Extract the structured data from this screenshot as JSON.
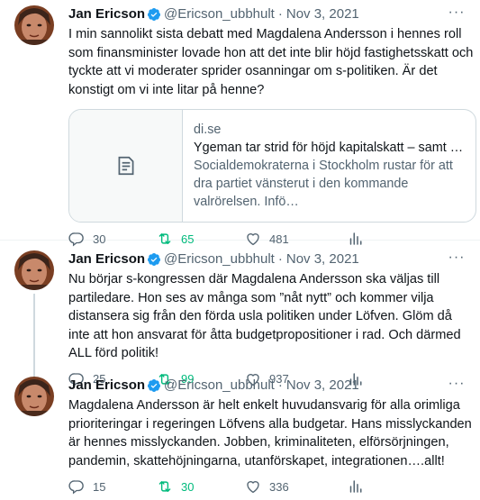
{
  "tweets": [
    {
      "author_name": "Jan Ericson",
      "handle": "@Ericson_ubbhult",
      "separator": "·",
      "date": "Nov 3, 2021",
      "text": "I min sannolikt sista debatt med Magdalena Andersson i hennes roll som finansminister lovade hon att det inte blir höjd fastighetsskatt och tyckte att vi moderater sprider osanningar om s-politiken. Är det konstigt om vi inte litar på henne?",
      "card": {
        "domain": "di.se",
        "title": "Ygeman tar strid för höjd kapitalskatt – samt fastig…",
        "description": "Socialdemokraterna i Stockholm rustar för att dra partiet vänsterut i den kommande valrörelsen. Infö…"
      },
      "replies": "30",
      "retweets": "65",
      "likes": "481"
    },
    {
      "author_name": "Jan Ericson",
      "handle": "@Ericson_ubbhult",
      "separator": "·",
      "date": "Nov 3, 2021",
      "text": "Nu börjar s-kongressen där Magdalena Andersson ska väljas till partiledare. Hon ses av många som ”nåt nytt” och kommer vilja distansera sig från den förda usla politiken under Löfven. Glöm då inte att hon ansvarat för åtta budgetpropositioner i rad. Och därmed ALL förd politik!",
      "replies": "25",
      "retweets": "99",
      "likes": "937"
    },
    {
      "author_name": "Jan Ericson",
      "handle": "@Ericson_ubbhult",
      "separator": "·",
      "date": "Nov 3, 2021",
      "text": "Magdalena Andersson är helt enkelt huvudansvarig för alla orimliga prioriteringar i regeringen Löfvens alla budgetar. Hans misslyckanden är hennes misslyckanden. Jobben, kriminaliteten, elförsörjningen, pandemin, skattehöjningarna, utanförskapet, integrationen….allt!",
      "replies": "15",
      "retweets": "30",
      "likes": "336"
    }
  ],
  "more_glyph": "···",
  "icons": {
    "verified": "verified-badge-icon",
    "reply": "reply-icon",
    "retweet": "retweet-icon",
    "like": "heart-icon",
    "share": "analytics-icon",
    "card_placeholder": "article-icon"
  },
  "colors": {
    "text": "#0f1419",
    "secondary": "#536471",
    "verified": "#1d9bf0",
    "retweeted": "#00ba7c",
    "border": "#cfd9de"
  }
}
